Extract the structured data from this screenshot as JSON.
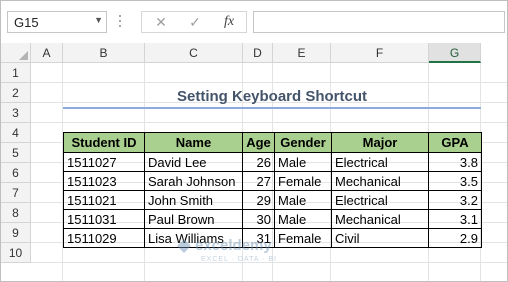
{
  "formula_bar": {
    "name_box": "G15",
    "cancel_glyph": "✕",
    "enter_glyph": "✓",
    "fx_label": "fx",
    "formula": ""
  },
  "columns": [
    "A",
    "B",
    "C",
    "D",
    "E",
    "F",
    "G"
  ],
  "selected_column": "G",
  "rows": [
    "1",
    "2",
    "3",
    "4",
    "5",
    "6",
    "7",
    "8",
    "9",
    "10"
  ],
  "title": "Setting Keyboard Shortcut",
  "table": {
    "headers": [
      "Student ID",
      "Name",
      "Age",
      "Gender",
      "Major",
      "GPA"
    ],
    "rows": [
      [
        "1511027",
        "David Lee",
        "26",
        "Male",
        "Electrical",
        "3.8"
      ],
      [
        "1511023",
        "Sarah Johnson",
        "27",
        "Female",
        "Mechanical",
        "3.5"
      ],
      [
        "1511021",
        "John Smith",
        "29",
        "Male",
        "Electrical",
        "3.2"
      ],
      [
        "1511031",
        "Paul Brown",
        "30",
        "Male",
        "Mechanical",
        "3.1"
      ],
      [
        "1511029",
        "Lisa Williams",
        "31",
        "Female",
        "Civil",
        "2.9"
      ]
    ]
  },
  "watermark": {
    "name": "exceldemy",
    "tagline": "EXCEL · DATA · BI"
  },
  "colors": {
    "header_fill": "#a9d08e",
    "title_color": "#44546a",
    "title_underline": "#8ea9db",
    "selected_column_accent": "#217346"
  }
}
